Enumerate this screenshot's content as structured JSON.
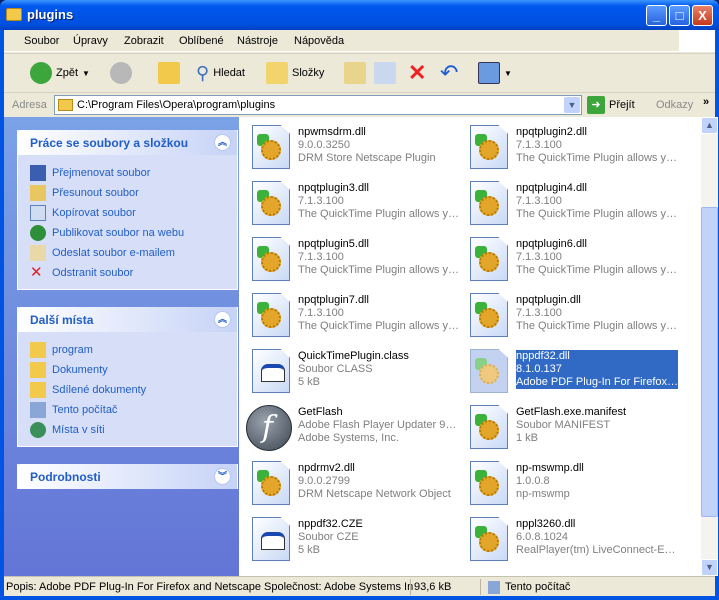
{
  "window": {
    "title": "plugins",
    "minimize": "_",
    "maximize": "□",
    "close": "X"
  },
  "menu": [
    "Soubor",
    "Úpravy",
    "Zobrazit",
    "Oblíbené",
    "Nástroje",
    "Nápověda"
  ],
  "toolbar": {
    "back": "Zpět",
    "search": "Hledat",
    "folders": "Složky"
  },
  "address": {
    "label": "Adresa",
    "value": "C:\\Program Files\\Opera\\program\\plugins",
    "go": "Přejít",
    "links": "Odkazy"
  },
  "tasks": {
    "title": "Práce se soubory a složkou",
    "items": [
      "Přejmenovat soubor",
      "Přesunout soubor",
      "Kopírovat soubor",
      "Publikovat soubor na webu",
      "Odeslat soubor e-mailem",
      "Odstranit soubor"
    ]
  },
  "places": {
    "title": "Další místa",
    "items": [
      "program",
      "Dokumenty",
      "Sdílené dokumenty",
      "Tento počítač",
      "Místa v síti"
    ]
  },
  "details": {
    "title": "Podrobnosti"
  },
  "files": [
    {
      "name": "npwmsdrm.dll",
      "l2": "9.0.0.3250",
      "l3": "DRM Store Netscape Plugin",
      "type": "dll"
    },
    {
      "name": "npqtplugin2.dll",
      "l2": "7.1.3.100",
      "l3": "The QuickTime Plugin allows y…",
      "type": "dll"
    },
    {
      "name": "npqtplugin3.dll",
      "l2": "7.1.3.100",
      "l3": "The QuickTime Plugin allows y…",
      "type": "dll"
    },
    {
      "name": "npqtplugin4.dll",
      "l2": "7.1.3.100",
      "l3": "The QuickTime Plugin allows y…",
      "type": "dll"
    },
    {
      "name": "npqtplugin5.dll",
      "l2": "7.1.3.100",
      "l3": "The QuickTime Plugin allows y…",
      "type": "dll"
    },
    {
      "name": "npqtplugin6.dll",
      "l2": "7.1.3.100",
      "l3": "The QuickTime Plugin allows y…",
      "type": "dll"
    },
    {
      "name": "npqtplugin7.dll",
      "l2": "7.1.3.100",
      "l3": "The QuickTime Plugin allows y…",
      "type": "dll"
    },
    {
      "name": "npqtplugin.dll",
      "l2": "7.1.3.100",
      "l3": "The QuickTime Plugin allows y…",
      "type": "dll"
    },
    {
      "name": "QuickTimePlugin.class",
      "l2": "Soubor CLASS",
      "l3": "5 kB",
      "type": "cls"
    },
    {
      "name": "nppdf32.dll",
      "l2": "8.1.0.137",
      "l3": "Adobe PDF Plug-In For Firefox…",
      "type": "dll",
      "selected": true
    },
    {
      "name": "GetFlash",
      "l2": "Adobe Flash Player Updater 9…",
      "l3": "Adobe Systems, Inc.",
      "type": "flash"
    },
    {
      "name": "GetFlash.exe.manifest",
      "l2": "Soubor MANIFEST",
      "l3": "1 kB",
      "type": "dll"
    },
    {
      "name": "npdrmv2.dll",
      "l2": "9.0.0.2799",
      "l3": "DRM Netscape Network Object",
      "type": "dll"
    },
    {
      "name": "np-mswmp.dll",
      "l2": "1.0.0.8",
      "l3": "np-mswmp",
      "type": "dll"
    },
    {
      "name": "nppdf32.CZE",
      "l2": "Soubor CZE",
      "l3": "5 kB",
      "type": "cls"
    },
    {
      "name": "nppl3260.dll",
      "l2": "6.0.8.1024",
      "l3": "RealPlayer(tm) LiveConnect-E…",
      "type": "dll"
    }
  ],
  "status": {
    "description": "Popis: Adobe PDF Plug-In For Firefox and Netscape Společnost: Adobe Systems In",
    "size": "93,6 kB",
    "location": "Tento počítač"
  }
}
